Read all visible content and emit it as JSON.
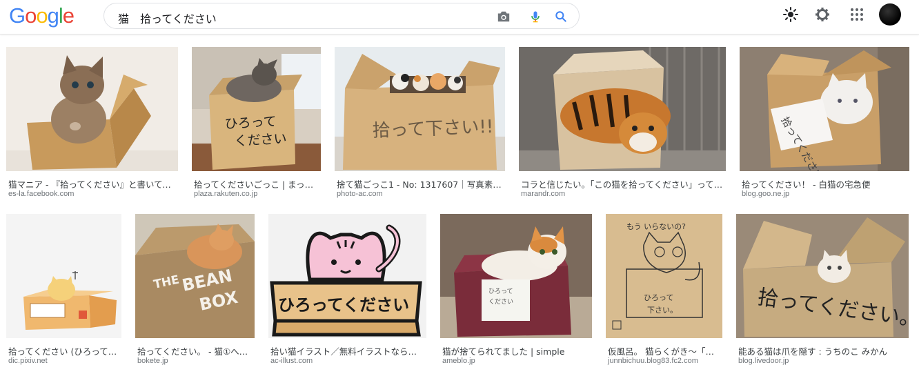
{
  "header": {
    "logo": [
      "G",
      "o",
      "o",
      "g",
      "l",
      "e"
    ],
    "logo_colors": [
      "#4285F4",
      "#EA4335",
      "#FBBC05",
      "#4285F4",
      "#34A853",
      "#EA4335"
    ],
    "search_value": "猫　拾ってください",
    "icons": [
      "camera-icon",
      "microphone-icon",
      "search-icon",
      "brightness-icon",
      "gear-icon",
      "apps-icon",
      "avatar"
    ]
  },
  "results": [
    {
      "caption": "猫マニア - 『拾ってください』と書いてあ…",
      "source": "es-la.facebook.com",
      "box_text": ""
    },
    {
      "caption": "拾ってくださいごっこ | まった…",
      "source": "plaza.rakuten.co.jp",
      "box_text": "ひろって\nください"
    },
    {
      "caption": "捨て猫ごっこ1 - No: 1317607｜写真素材…",
      "source": "photo-ac.com",
      "box_text": "拾って下さい!!"
    },
    {
      "caption": "コラと信じたい。「この猫を拾ってください」って…",
      "source": "marandr.com",
      "box_text": ""
    },
    {
      "caption": "拾ってください！ - 白猫の宅急便",
      "source": "blog.goo.ne.jp",
      "box_text": "拾ってください。"
    },
    {
      "caption": "拾ってください (ひろって…",
      "source": "dic.pixiv.net",
      "box_text": ""
    },
    {
      "caption": "拾ってください。 - 猫①への…",
      "source": "bokete.jp",
      "box_text": "THE BEAN BOX"
    },
    {
      "caption": "拾い猫イラスト／無料イラストなら「…",
      "source": "ac-illust.com",
      "box_text": "ひろってください"
    },
    {
      "caption": "猫が捨てられてました | simple",
      "source": "ameblo.jp",
      "box_text": ""
    },
    {
      "caption": "仮風呂。 猫らくがき〜「拾…",
      "source": "junnbichuu.blog83.fc2.com",
      "box_text": "もう いらないの?\nひろって\n下さい。"
    },
    {
      "caption": "能ある猫は爪を隠す : うちのこ みかん",
      "source": "blog.livedoor.jp",
      "box_text": "拾ってください。"
    }
  ]
}
